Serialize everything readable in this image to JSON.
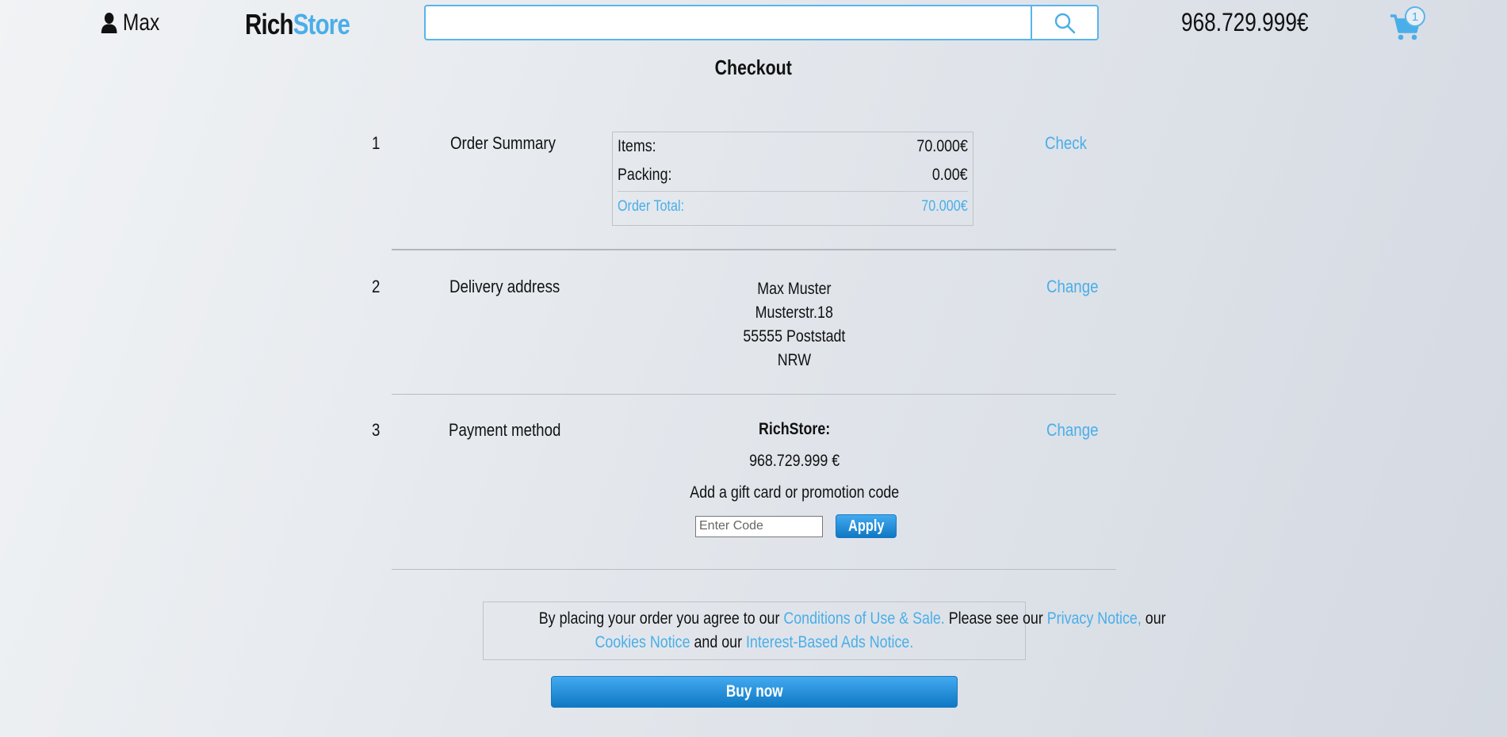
{
  "header": {
    "user_name": "Max",
    "logo_rich": "Rich",
    "logo_store": "Store",
    "search_placeholder": "",
    "balance": "968.729.999€",
    "cart_count": "1"
  },
  "page_title": "Checkout",
  "steps": {
    "summary": {
      "number": "1",
      "label": "Order Summary",
      "action": "Check",
      "items_label": "Items:",
      "items_value": "70.000€",
      "packing_label": "Packing:",
      "packing_value": "0.00€",
      "total_label": "Order Total:",
      "total_value": "70.000€"
    },
    "delivery": {
      "number": "2",
      "label": "Delivery address",
      "action": "Change",
      "name": "Max Muster",
      "street": "Musterstr.18",
      "city": "55555 Poststadt",
      "region": "NRW"
    },
    "payment": {
      "number": "3",
      "label": "Payment method",
      "action": "Change",
      "provider": "RichStore:",
      "amount": "968.729.999 €",
      "promo_text": "Add a gift card or promotion code",
      "promo_placeholder": "Enter Code",
      "apply_label": "Apply"
    }
  },
  "terms": {
    "prefix": "By placing your order you agree to our ",
    "conditions_link": "Conditions of Use & Sale.",
    "mid": " Please see our ",
    "privacy_link": "Privacy Notice,",
    "our": " our",
    "cookies_link": "Cookies Notice",
    "and_our": " and our ",
    "ads_link": "Interest-Based Ads Notice."
  },
  "buy_label": "Buy now",
  "colors": {
    "accent": "#4aaee8",
    "button": "#1a86d0"
  }
}
